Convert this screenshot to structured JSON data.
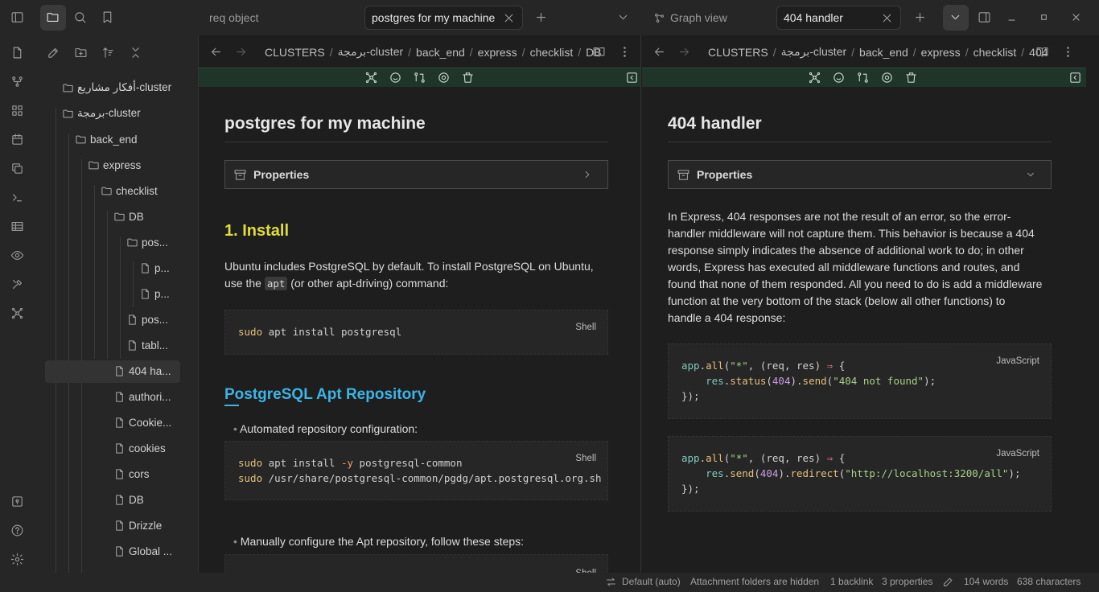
{
  "titlebar": {
    "tabs_left": [
      {
        "label": "req object"
      },
      {
        "label": "postgres for my machine"
      }
    ],
    "tabs_right": [
      {
        "label": "Graph view"
      },
      {
        "label": "404 handler"
      }
    ]
  },
  "sidebar": {
    "tree": [
      {
        "label": "أفكار مشاريع-cluster",
        "type": "folder"
      },
      {
        "label": "برمجة-cluster",
        "type": "folder"
      },
      {
        "label": "back_end",
        "type": "folder"
      },
      {
        "label": "express",
        "type": "folder"
      },
      {
        "label": "checklist",
        "type": "folder"
      },
      {
        "label": "DB",
        "type": "folder"
      },
      {
        "label": "pos...",
        "type": "folder"
      },
      {
        "label": "p...",
        "type": "file"
      },
      {
        "label": "p...",
        "type": "file"
      },
      {
        "label": "pos...",
        "type": "file"
      },
      {
        "label": "tabl...",
        "type": "file"
      },
      {
        "label": "404 ha...",
        "type": "file"
      },
      {
        "label": "authori...",
        "type": "file"
      },
      {
        "label": "Cookie...",
        "type": "file"
      },
      {
        "label": "cookies",
        "type": "file"
      },
      {
        "label": "cors",
        "type": "file"
      },
      {
        "label": "DB",
        "type": "file"
      },
      {
        "label": "Drizzle",
        "type": "file"
      },
      {
        "label": "Global ...",
        "type": "file"
      }
    ]
  },
  "pane1": {
    "breadcrumb": [
      "CLUSTERS",
      "برمجة-cluster",
      "back_end",
      "express",
      "checklist",
      "DB"
    ],
    "title": "postgres for my machine",
    "properties_label": "Properties",
    "heading1": "1. Install",
    "para1_a": "Ubuntu includes PostgreSQL by default. To install PostgreSQL on Ubuntu,",
    "para1_b": "use the",
    "para1_code": "apt",
    "para1_c": "(or other apt-driving) command:",
    "code1_lang": "Shell",
    "heading2": "PostgreSQL Apt Repository",
    "bullet1": "Automated repository configuration:",
    "code2_lang": "Shell",
    "bullet2": "Manually configure the Apt repository, follow these steps:",
    "code3_lang": "Shell"
  },
  "pane2": {
    "breadcrumb": [
      "CLUSTERS",
      "برمجة-cluster",
      "back_end",
      "express",
      "checklist",
      "404"
    ],
    "title": "404 handler",
    "properties_label": "Properties",
    "paragraph_lines": [
      "In Express, 404 responses are not the result of an error, so the error-",
      "handler middleware will not capture them. This behavior is because a 404",
      "response simply indicates the absence of additional work to do; in other",
      "words, Express has executed all middleware functions and routes, and",
      "found that none of them responded. All you need to do is add a middleware",
      "function at the very bottom of the stack (below all other functions) to",
      "handle a 404 response:"
    ],
    "code1_lang": "JavaScript",
    "code2_lang": "JavaScript"
  },
  "statusbar": {
    "mode": "Default (auto)",
    "attachments": "Attachment folders are hidden",
    "backlinks": "1 backlink",
    "properties": "3 properties",
    "words": "104 words",
    "characters": "638 characters"
  },
  "colors": {
    "accent_yellow": "#e0de3c",
    "accent_cyan": "#3cb4e6",
    "green_toolbar": "#20352a"
  }
}
